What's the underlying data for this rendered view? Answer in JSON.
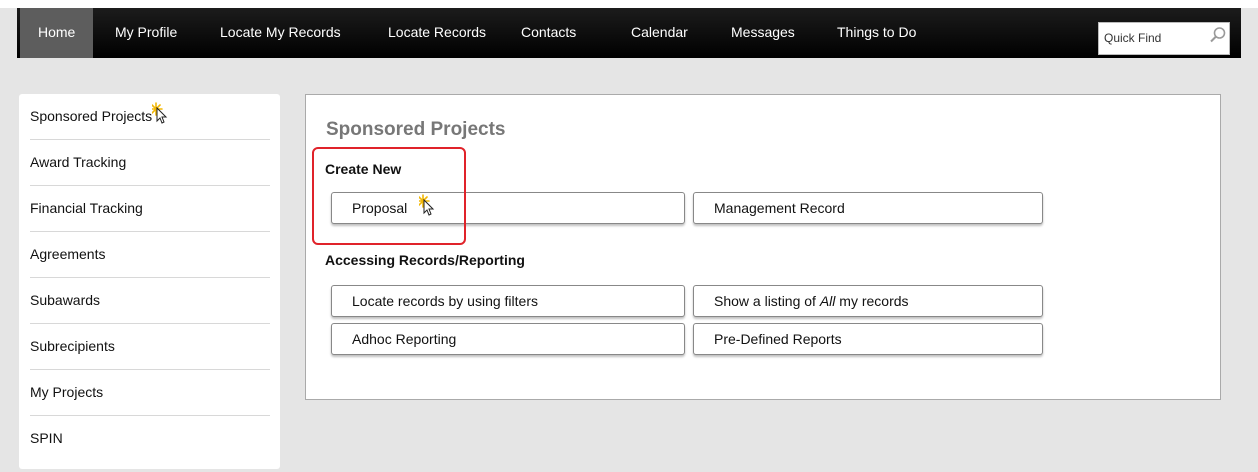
{
  "nav": {
    "items": [
      {
        "label": "Home",
        "active": true
      },
      {
        "label": "My Profile",
        "active": false
      },
      {
        "label": "Locate My Records",
        "active": false
      },
      {
        "label": "Locate Records",
        "active": false
      },
      {
        "label": "Contacts",
        "active": false
      },
      {
        "label": "Calendar",
        "active": false
      },
      {
        "label": "Messages",
        "active": false
      },
      {
        "label": "Things to Do",
        "active": false
      }
    ],
    "quick_find": {
      "value": "",
      "placeholder": "Quick Find",
      "icon": "search-icon"
    }
  },
  "sidebar": {
    "items": [
      {
        "label": "Sponsored Projects"
      },
      {
        "label": "Award Tracking"
      },
      {
        "label": "Financial Tracking"
      },
      {
        "label": "Agreements"
      },
      {
        "label": "Subawards"
      },
      {
        "label": "Subrecipients"
      },
      {
        "label": "My Projects"
      },
      {
        "label": "SPIN"
      }
    ]
  },
  "main": {
    "title": "Sponsored Projects",
    "create_new": {
      "heading": "Create New",
      "buttons": [
        {
          "label": "Proposal"
        },
        {
          "label": "Management Record"
        }
      ]
    },
    "accessing": {
      "heading": "Accessing Records/Reporting",
      "buttons": [
        {
          "label": "Locate records by using filters"
        },
        {
          "label_pre": "Show a listing of ",
          "label_em": "All",
          "label_post": " my records"
        },
        {
          "label": "Adhoc Reporting"
        },
        {
          "label": "Pre-Defined Reports"
        }
      ]
    }
  },
  "colors": {
    "navbar": "#000000",
    "nav_active": "#5d5d5d",
    "highlight": "#e0232a",
    "title_gray": "#777777"
  }
}
